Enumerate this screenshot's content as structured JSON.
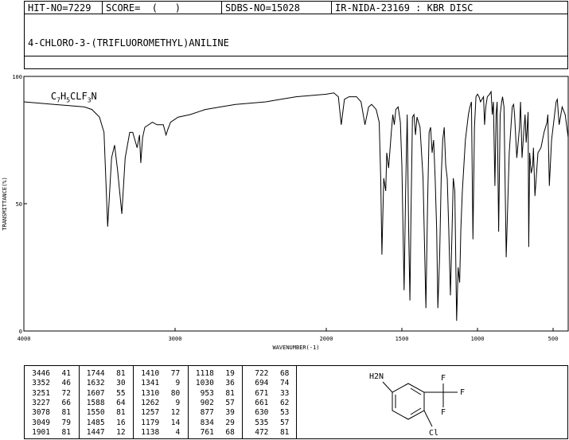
{
  "header": {
    "hit_no": "HIT-NO=7229",
    "score": "SCORE=  (   )",
    "sdbs_no": "SDBS-NO=15028",
    "ir_nida": "IR-NIDA-23169 : KBR DISC"
  },
  "compound": {
    "name": "4-CHLORO-3-(TRIFLUOROMETHYL)ANILINE",
    "formula_parts": [
      "C",
      "7",
      "H",
      "5",
      "CLF",
      "3",
      "N"
    ]
  },
  "chart_data": {
    "type": "line",
    "title": "",
    "xlabel": "WAVENUMBER(-1)",
    "ylabel": "TRANSMITTANCE(%)",
    "xlim": [
      4000,
      400
    ],
    "ylim": [
      0,
      100
    ],
    "x_ticks": [
      4000,
      3000,
      2000,
      1500,
      1000,
      500
    ],
    "y_ticks": [
      0,
      50,
      100
    ],
    "grid": false,
    "series": [
      {
        "name": "",
        "color": "#000000",
        "x": [
          4000,
          3900,
          3800,
          3700,
          3600,
          3550,
          3500,
          3470,
          3446,
          3420,
          3400,
          3380,
          3352,
          3330,
          3300,
          3280,
          3251,
          3235,
          3227,
          3215,
          3200,
          3150,
          3120,
          3078,
          3060,
          3049,
          3030,
          2980,
          2900,
          2800,
          2700,
          2600,
          2500,
          2400,
          2300,
          2200,
          2100,
          2000,
          1950,
          1920,
          1901,
          1880,
          1850,
          1800,
          1770,
          1744,
          1720,
          1700,
          1670,
          1650,
          1640,
          1632,
          1620,
          1607,
          1600,
          1588,
          1580,
          1570,
          1560,
          1550,
          1540,
          1525,
          1510,
          1500,
          1485,
          1475,
          1465,
          1455,
          1447,
          1440,
          1430,
          1420,
          1410,
          1400,
          1380,
          1360,
          1341,
          1330,
          1320,
          1310,
          1300,
          1290,
          1280,
          1270,
          1262,
          1250,
          1240,
          1230,
          1220,
          1210,
          1200,
          1190,
          1179,
          1170,
          1160,
          1150,
          1138,
          1128,
          1118,
          1110,
          1100,
          1090,
          1080,
          1070,
          1060,
          1050,
          1040,
          1030,
          1020,
          1010,
          1000,
          990,
          980,
          970,
          960,
          953,
          945,
          935,
          920,
          910,
          902,
          895,
          885,
          877,
          870,
          860,
          850,
          840,
          834,
          825,
          810,
          790,
          770,
          761,
          755,
          740,
          722,
          715,
          705,
          694,
          685,
          678,
          671,
          665,
          661,
          655,
          645,
          635,
          630,
          620,
          600,
          580,
          560,
          540,
          535,
          525,
          510,
          490,
          480,
          472,
          460,
          440,
          420,
          400
        ],
        "y": [
          90,
          89.5,
          89,
          88.5,
          88,
          87,
          84,
          78,
          41,
          68,
          73,
          63,
          46,
          68,
          78,
          78,
          72,
          77,
          66,
          76,
          80,
          82,
          81,
          81,
          77,
          79,
          82,
          84,
          85,
          87,
          88,
          89,
          89.5,
          90,
          91,
          92,
          92.5,
          93,
          93.5,
          92,
          81,
          91,
          92,
          92,
          90,
          81,
          88,
          89,
          87,
          82,
          60,
          30,
          60,
          55,
          70,
          64,
          70,
          78,
          85,
          81,
          87,
          88,
          82,
          65,
          16,
          55,
          85,
          40,
          12,
          45,
          84,
          85,
          77,
          84,
          80,
          60,
          9,
          50,
          78,
          80,
          70,
          75,
          60,
          40,
          9,
          30,
          60,
          75,
          80,
          65,
          60,
          40,
          14,
          35,
          60,
          55,
          4,
          25,
          19,
          40,
          55,
          65,
          75,
          80,
          85,
          88,
          90,
          36,
          80,
          92,
          93,
          92,
          90,
          91,
          92,
          81,
          88,
          92,
          93,
          94,
          85,
          90,
          57,
          85,
          90,
          39,
          85,
          90,
          92,
          88,
          29,
          70,
          88,
          89,
          85,
          68,
          80,
          90,
          68,
          78,
          85,
          74,
          80,
          86,
          33,
          70,
          62,
          65,
          72,
          53,
          70,
          72,
          78,
          82,
          85,
          57,
          75,
          85,
          90,
          91,
          81,
          88,
          85,
          76
        ]
      }
    ]
  },
  "peaks": {
    "columns": [
      [
        [
          "3446",
          "41"
        ],
        [
          "3352",
          "46"
        ],
        [
          "3251",
          "72"
        ],
        [
          "3227",
          "66"
        ],
        [
          "3078",
          "81"
        ],
        [
          "3049",
          "79"
        ],
        [
          "1901",
          "81"
        ]
      ],
      [
        [
          "1744",
          "81"
        ],
        [
          "1632",
          "30"
        ],
        [
          "1607",
          "55"
        ],
        [
          "1588",
          "64"
        ],
        [
          "1550",
          "81"
        ],
        [
          "1485",
          "16"
        ],
        [
          "1447",
          "12"
        ]
      ],
      [
        [
          "1410",
          "77"
        ],
        [
          "1341",
          "9"
        ],
        [
          "1310",
          "80"
        ],
        [
          "1262",
          "9"
        ],
        [
          "1257",
          "12"
        ],
        [
          "1179",
          "14"
        ],
        [
          "1138",
          "4"
        ]
      ],
      [
        [
          "1118",
          "19"
        ],
        [
          "1030",
          "36"
        ],
        [
          "953",
          "81"
        ],
        [
          "902",
          "57"
        ],
        [
          "877",
          "39"
        ],
        [
          "834",
          "29"
        ],
        [
          "761",
          "68"
        ]
      ],
      [
        [
          "722",
          "68"
        ],
        [
          "694",
          "74"
        ],
        [
          "671",
          "33"
        ],
        [
          "661",
          "62"
        ],
        [
          "630",
          "53"
        ],
        [
          "535",
          "57"
        ],
        [
          "472",
          "81"
        ]
      ]
    ]
  },
  "structure": {
    "amine_label": "H2N",
    "f_top": "F",
    "f_right": "F",
    "f_bottom": "F",
    "cl_label": "Cl"
  }
}
